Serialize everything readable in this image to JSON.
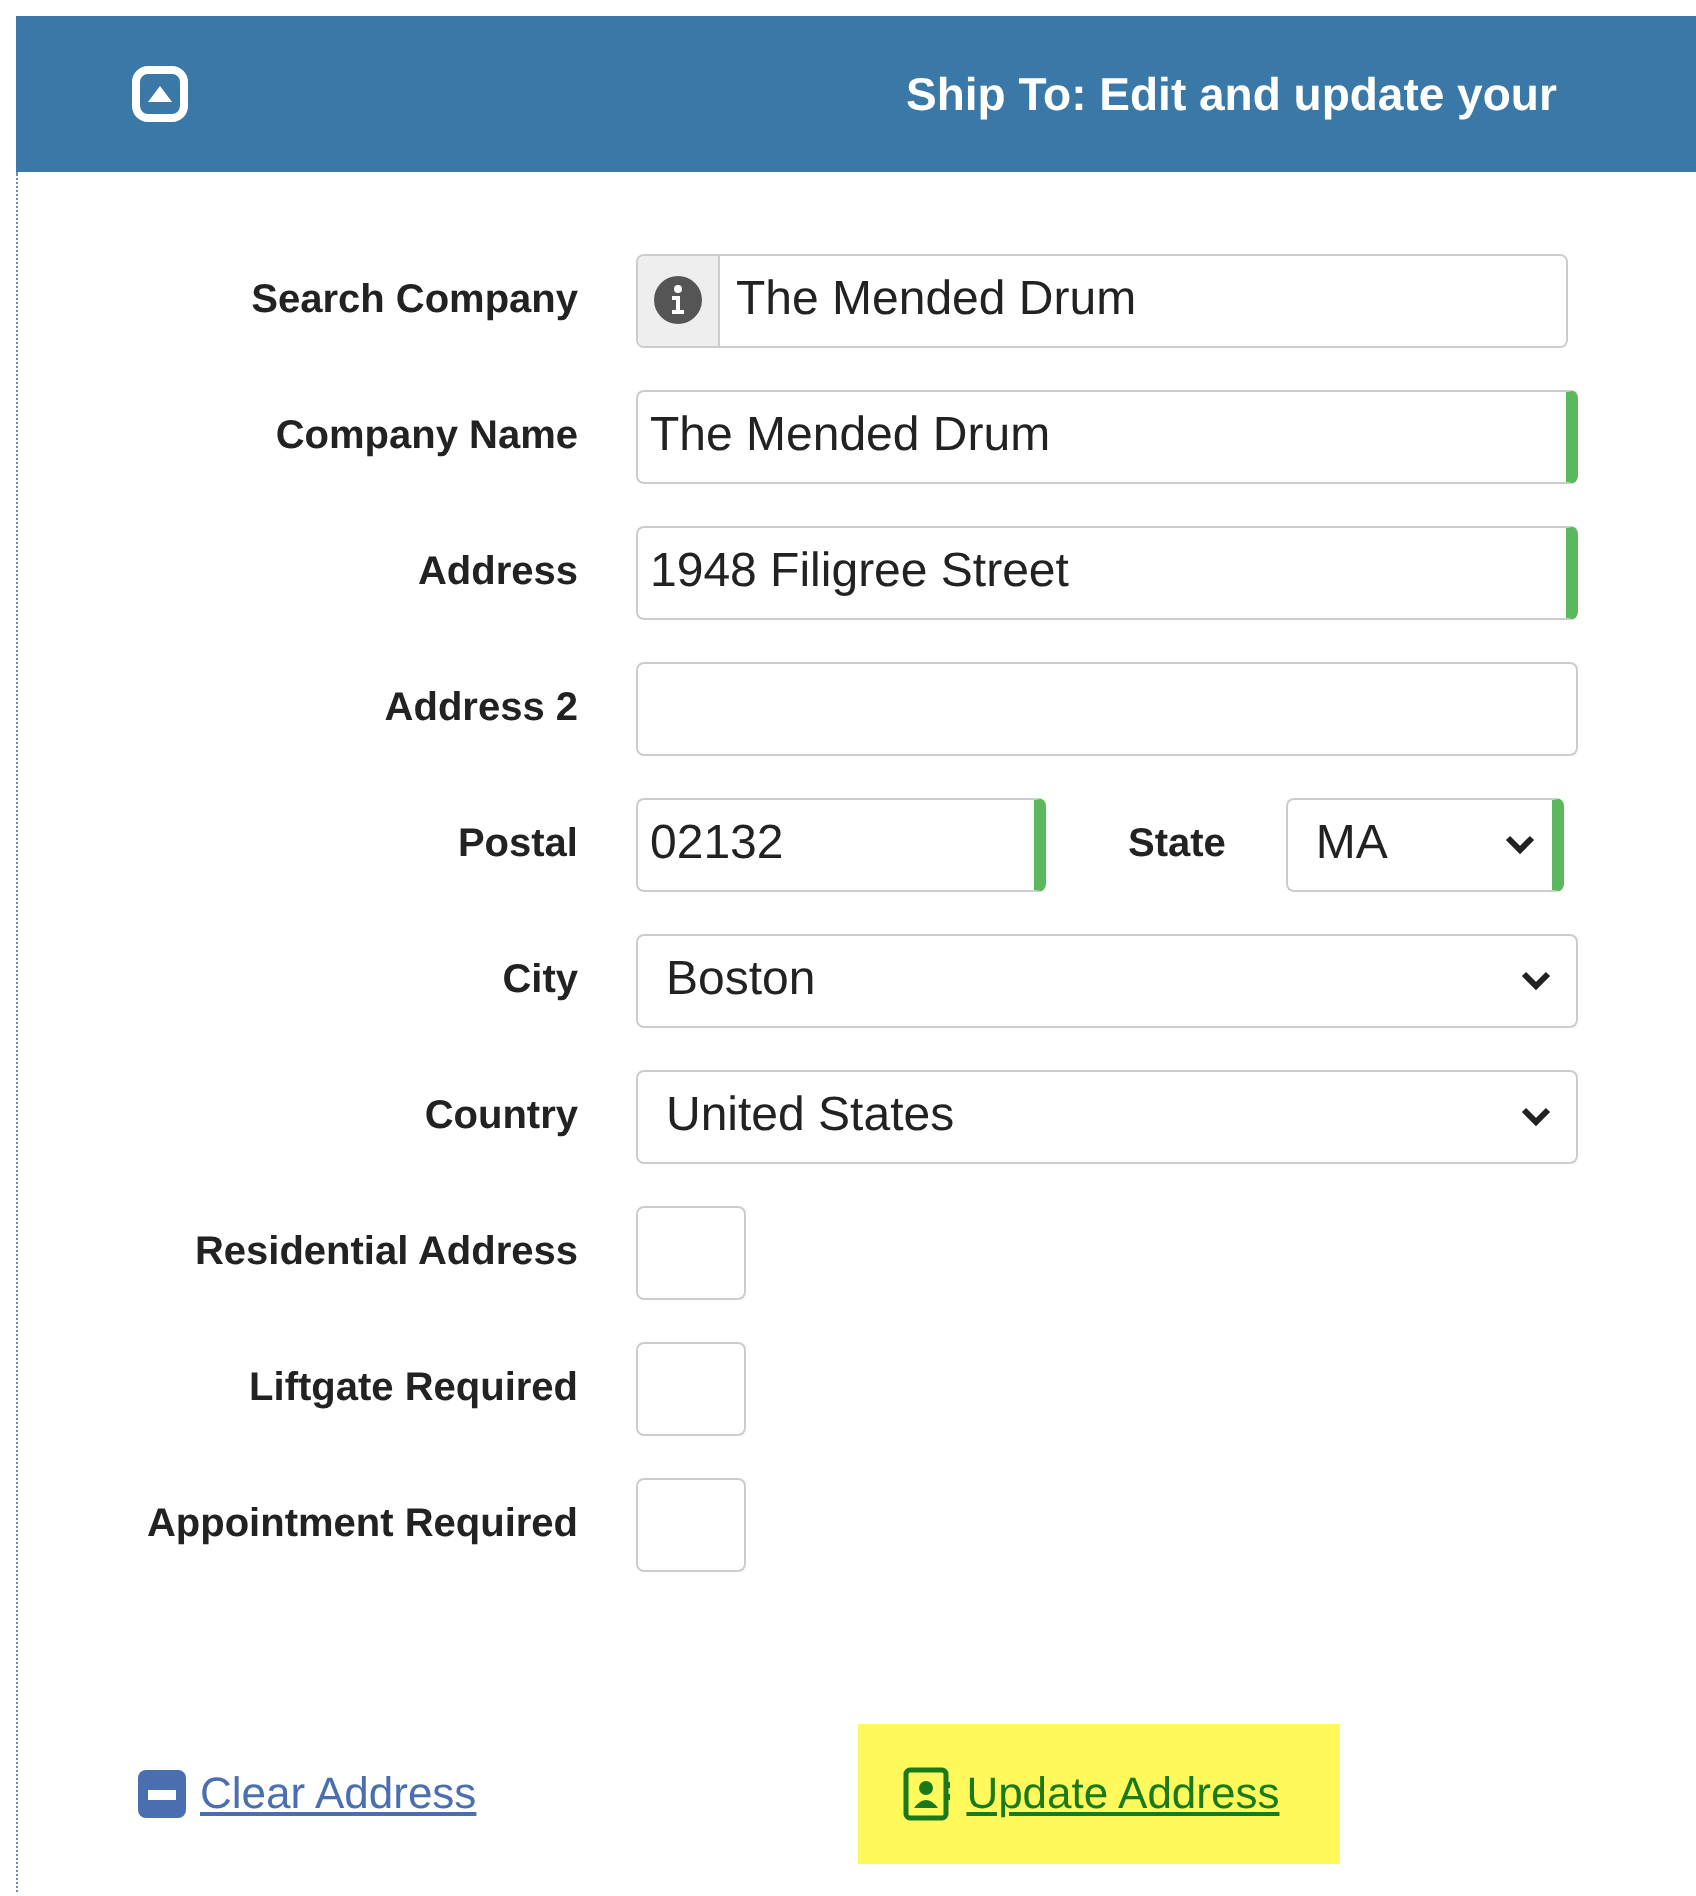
{
  "panel": {
    "title": "Ship To: Edit and update your"
  },
  "rows": [
    {
      "label": "Search Company",
      "kind": "search",
      "value": "The Mended Drum"
    },
    {
      "label": "Company Name",
      "kind": "text",
      "value": "The Mended Drum",
      "valid": true
    },
    {
      "label": "Address",
      "kind": "text",
      "value": "1948 Filigree Street",
      "valid": true
    },
    {
      "label": "Address 2",
      "kind": "text",
      "valid": false
    },
    {
      "label": "Postal",
      "kind": "text",
      "value": "02132",
      "valid": true,
      "pair": {
        "label": "State",
        "kind": "select",
        "value": "MA",
        "valid": true
      }
    },
    {
      "label": "City",
      "kind": "select",
      "value": "Boston",
      "valid": false
    },
    {
      "label": "Country",
      "kind": "select",
      "value": "United States",
      "valid": false
    },
    {
      "label": "Residential Address",
      "kind": "checkbox",
      "checked": false
    },
    {
      "label": "Liftgate Required",
      "kind": "checkbox",
      "checked": false
    },
    {
      "label": "Appointment Required",
      "kind": "checkbox",
      "checked": false
    }
  ],
  "actions": [
    {
      "label": "Clear Address",
      "kind": "clear",
      "highlighted": false
    },
    {
      "label": "Update Address",
      "kind": "update",
      "highlighted": true
    }
  ]
}
